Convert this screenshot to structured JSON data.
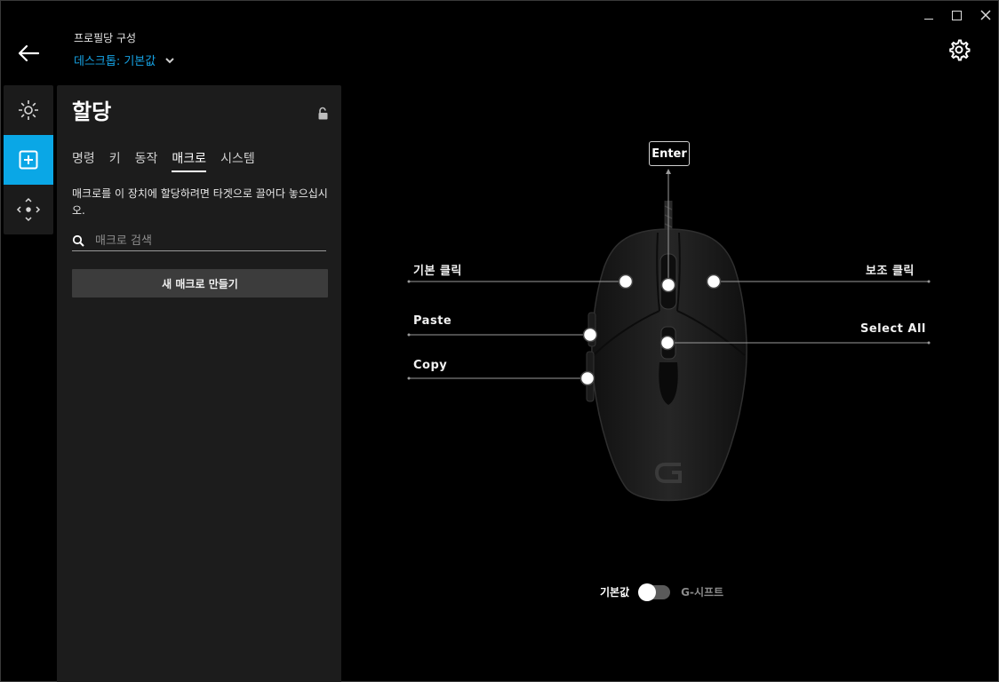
{
  "header": {
    "breadcrumb": "프로필당 구성",
    "profile_name": "데스크톱: 기본값"
  },
  "panel": {
    "title": "할당",
    "tabs": [
      {
        "label": "명령"
      },
      {
        "label": "키"
      },
      {
        "label": "동작"
      },
      {
        "label": "매크로"
      },
      {
        "label": "시스템"
      }
    ],
    "selected_tab": "매크로",
    "hint": "매크로를 이 장치에 할당하려면 타겟으로 끌어다 놓으십시오.",
    "search_placeholder": "매크로 검색",
    "new_macro_button": "새 매크로 만들기"
  },
  "assignments": {
    "top": "Enter",
    "left_click": "기본 클릭",
    "right_click": "보조 클릭",
    "side_front": "Paste",
    "side_back": "Copy",
    "center": "Select All"
  },
  "mode_toggle": {
    "left_label": "기본값",
    "right_label": "G-시프트",
    "state": "기본값"
  },
  "colors": {
    "accent": "#0aa7e6",
    "link": "#16a3e5",
    "panel_bg": "#1c1c1c",
    "background": "#000000"
  }
}
